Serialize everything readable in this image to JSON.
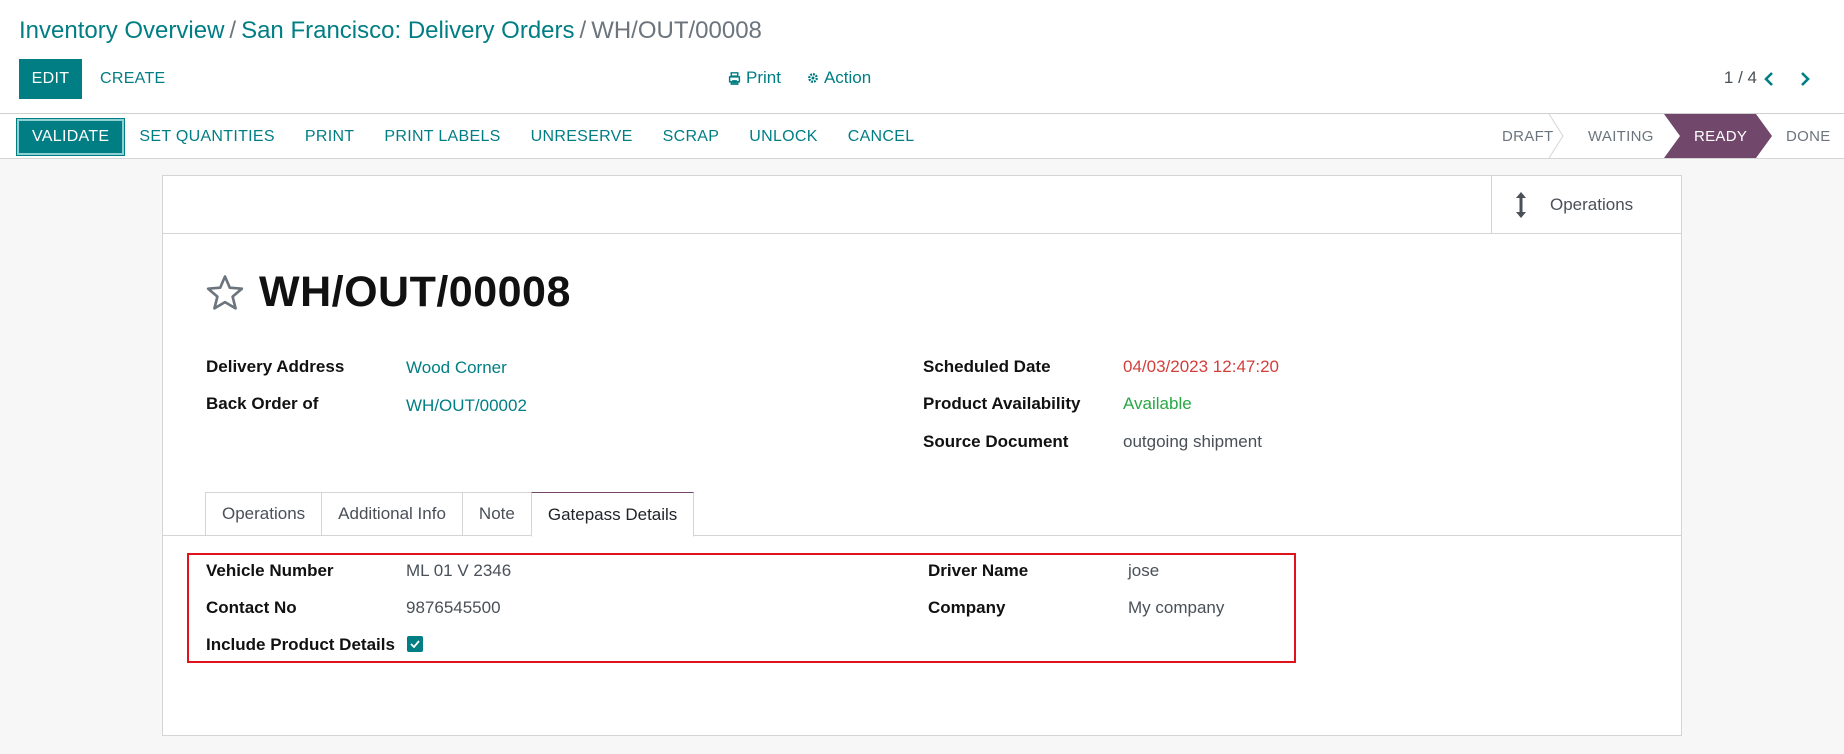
{
  "breadcrumb": {
    "items": [
      "Inventory Overview",
      "San Francisco: Delivery Orders"
    ],
    "current": "WH/OUT/00008"
  },
  "control": {
    "edit": "EDIT",
    "create": "CREATE",
    "print": "Print",
    "action": "Action",
    "pager": "1 / 4"
  },
  "statusbar": {
    "buttons": [
      "VALIDATE",
      "SET QUANTITIES",
      "PRINT",
      "PRINT LABELS",
      "UNRESERVE",
      "SCRAP",
      "UNLOCK",
      "CANCEL"
    ],
    "stages": [
      "DRAFT",
      "WAITING",
      "READY",
      "DONE"
    ],
    "active_stage": "READY"
  },
  "sheet": {
    "smart_button": "Operations",
    "title": "WH/OUT/00008",
    "fields": {
      "delivery_address_label": "Delivery Address",
      "delivery_address": "Wood Corner",
      "back_order_label": "Back Order of",
      "back_order": "WH/OUT/00002",
      "scheduled_date_label": "Scheduled Date",
      "scheduled_date": "04/03/2023 12:47:20",
      "availability_label": "Product Availability",
      "availability": "Available",
      "source_label": "Source Document",
      "source": "outgoing shipment"
    },
    "tabs": [
      "Operations",
      "Additional Info",
      "Note",
      "Gatepass Details"
    ],
    "active_tab": "Gatepass Details",
    "gatepass": {
      "vehicle_label": "Vehicle Number",
      "vehicle": "ML 01 V 2346",
      "contact_label": "Contact No",
      "contact": "9876545500",
      "include_label": "Include Product Details",
      "include": true,
      "driver_label": "Driver Name",
      "driver": "jose",
      "company_label": "Company",
      "company": "My company"
    }
  },
  "colors": {
    "primary": "#017e84",
    "stage_active": "#71476b",
    "date_overdue": "#d23f3a",
    "available": "#28a745",
    "highlight": "#e0121e"
  }
}
